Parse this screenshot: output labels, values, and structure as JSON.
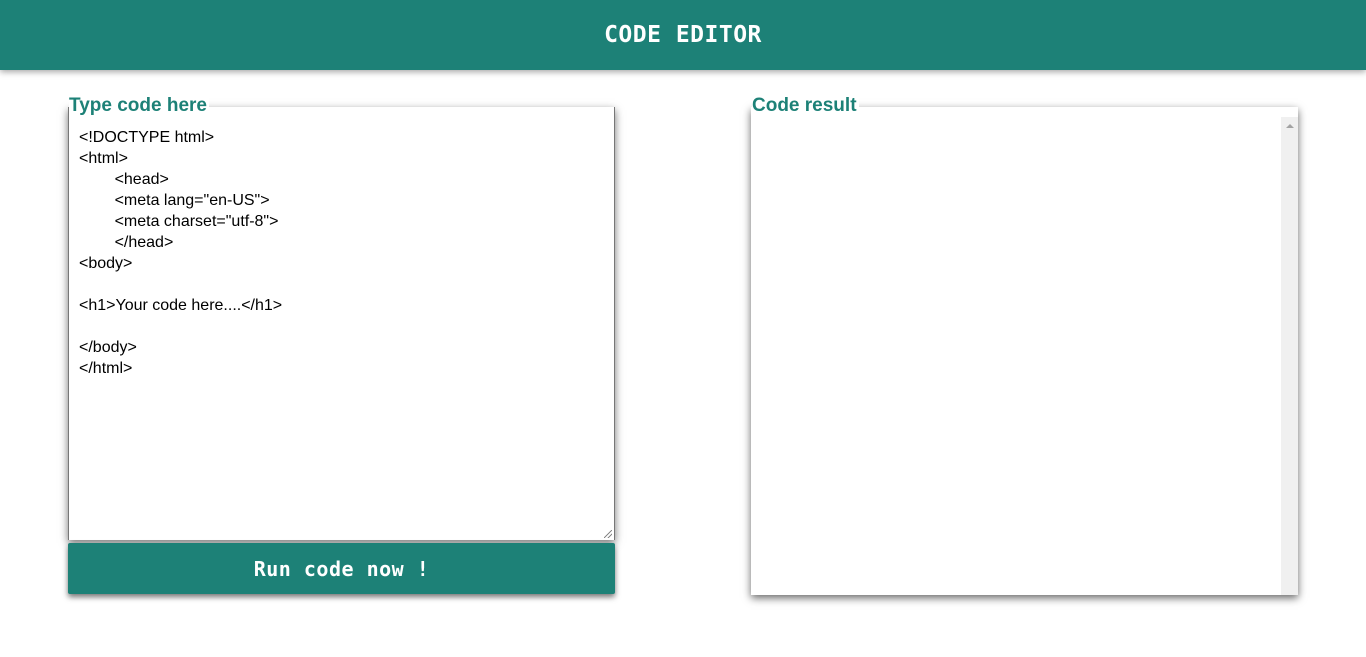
{
  "header": {
    "title": "CODE EDITOR"
  },
  "editor": {
    "label": "Type code here",
    "value": "<!DOCTYPE html>\n<html>\n\t<head>\n\t<meta lang=\"en-US\">\n\t<meta charset=\"utf-8\">\n\t</head>\n<body>\n\n<h1>Your code here....</h1>\n\n</body>\n</html>",
    "run_button_label": "Run code now !"
  },
  "result": {
    "label": "Code result"
  },
  "colors": {
    "accent": "#1d8177",
    "scrollbar_track": "#f0f0f0"
  },
  "icons": {
    "scroll_up": "chevron-up-icon",
    "resize_grip": "resize-grip-icon"
  }
}
